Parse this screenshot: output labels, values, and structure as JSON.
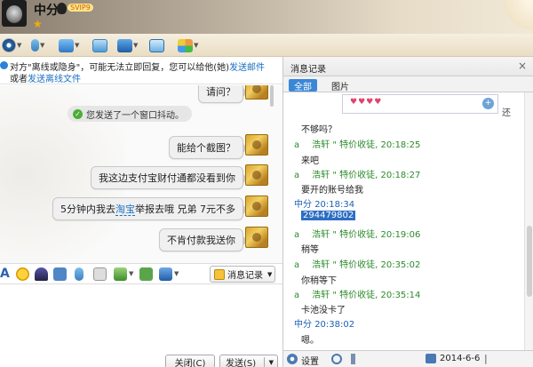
{
  "header": {
    "contact_name": "中分",
    "vip_label": "SVIP9"
  },
  "notice": {
    "line1_text": "对方\"离线或隐身\"，可能无法立即回复，您可以给他(她)",
    "line1_link": "发送邮件",
    "line2_text": "或者",
    "line2_link": "发送离线文件"
  },
  "chat": {
    "partial_top": "请问？",
    "shake_notice": "您发送了一个窗口抖动。",
    "messages": [
      {
        "text": "能给个截图？"
      },
      {
        "text": "我这边支付宝财付通都没看到你"
      },
      {
        "text_before": "5分钟内我去",
        "text_link": "淘宝",
        "text_after": "举报去哦 兄弟 7元不多"
      },
      {
        "text": "不肯付款我送你"
      }
    ]
  },
  "input_toolbar": {
    "font_label": "A",
    "history_label": "消息记录"
  },
  "buttons": {
    "close": "关闭(C)",
    "send": "发送(S)"
  },
  "history": {
    "title": "消息记录",
    "tabs": [
      "全部",
      "图片"
    ],
    "side_label": "还",
    "entries": [
      {
        "type": "text",
        "text": "不够吗？"
      },
      {
        "type": "head",
        "marker": "a",
        "name": "浩轩",
        "status": "\" 特价收徒",
        "time": "20:18:25"
      },
      {
        "type": "text",
        "text": "来吧"
      },
      {
        "type": "head",
        "marker": "a",
        "name": "浩轩",
        "status": "\" 特价收徒",
        "time": "20:18:27"
      },
      {
        "type": "text",
        "text": "要开的账号给我"
      },
      {
        "type": "self",
        "name": "中分",
        "time": "20:18:34"
      },
      {
        "type": "sel",
        "text": "294479802"
      },
      {
        "type": "head",
        "marker": "a",
        "name": "浩轩",
        "status": "\" 特价收徒",
        "time": "20:19:06"
      },
      {
        "type": "text",
        "text": "稍等"
      },
      {
        "type": "head",
        "marker": "a",
        "name": "浩轩",
        "status": "\" 特价收徒",
        "time": "20:35:02"
      },
      {
        "type": "text",
        "text": "你稍等下"
      },
      {
        "type": "head",
        "marker": "a",
        "name": "浩轩",
        "status": "\" 特价收徒",
        "time": "20:35:14"
      },
      {
        "type": "text",
        "text": "卡池没卡了"
      },
      {
        "type": "self",
        "name": "中分",
        "time": "20:38:02"
      },
      {
        "type": "text",
        "text": "嗯。"
      }
    ],
    "settings_label": "设置",
    "date": "2014-6-6"
  }
}
